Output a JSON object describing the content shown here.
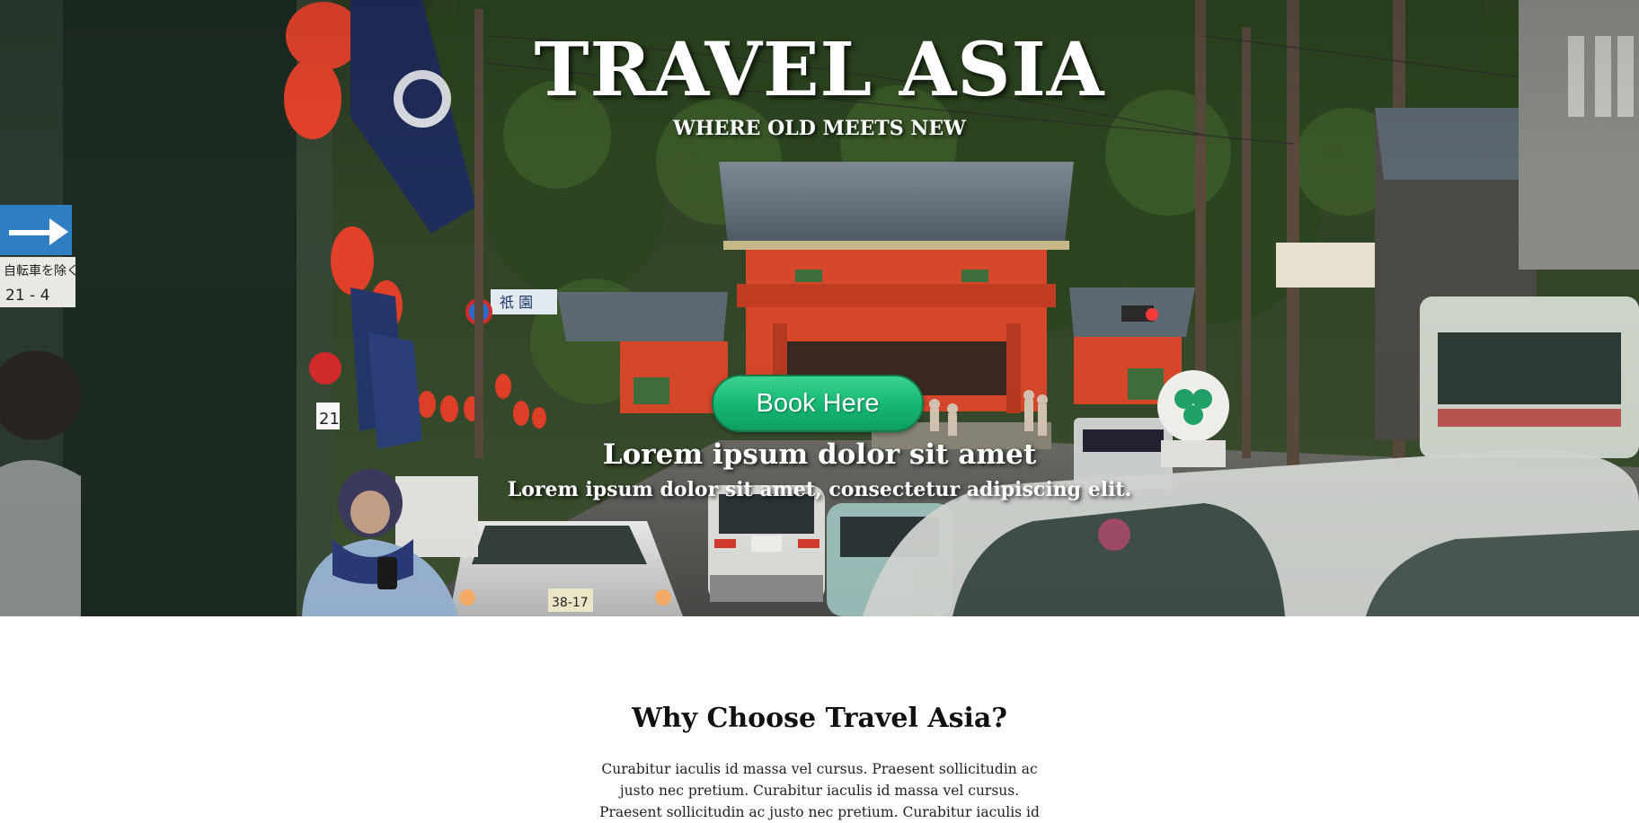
{
  "hero": {
    "title": "TRAVEL ASIA",
    "subtitle": "WHERE OLD MEETS NEW",
    "book_button_label": "Book Here",
    "tagline": "Lorem ipsum dolor sit amet",
    "tagline_sub": "Lorem ipsum dolor sit amet, consectetur adipiscing elit.",
    "photo": {
      "signs": {
        "arrow_sign": "自転車を除く",
        "arrow_sign_time": "21 - 4",
        "street_sign": "祇 園",
        "number_plate_post": "21",
        "taxi_plate": "38-17"
      }
    }
  },
  "why_section": {
    "title": "Why Choose Travel Asia?",
    "text": "Curabitur iaculis id massa vel cursus. Praesent sollicitudin ac justo nec pretium. Curabitur iaculis id massa vel cursus. Praesent sollicitudin ac justo nec pretium. Curabitur iaculis id"
  },
  "colors": {
    "button_green": "#16b572",
    "button_border": "#0f7a4a",
    "temple_red": "#d9482b",
    "foliage": "#2f4a22"
  }
}
